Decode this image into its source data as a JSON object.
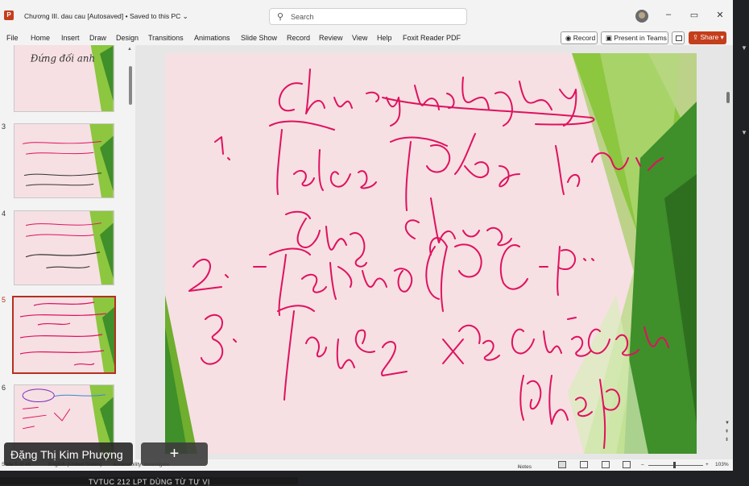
{
  "window": {
    "app_icon": "powerpoint-icon",
    "document_title": "Chương III. dau cau [Autosaved] • Saved to this PC ⌄",
    "search_placeholder": "Search",
    "controls": {
      "minimize": "–",
      "maximize": "▭",
      "close": "✕"
    }
  },
  "ribbon": {
    "tabs": [
      "File",
      "Home",
      "Insert",
      "Draw",
      "Design",
      "Transitions",
      "Animations",
      "Slide Show",
      "Record",
      "Review",
      "View",
      "Help",
      "Foxit Reader PDF"
    ],
    "record_label": "Record",
    "present_label": "Present in Teams",
    "share_label": "Share"
  },
  "thumbnails": {
    "items": [
      {
        "number": "",
        "caption": "Đứng đối anh"
      },
      {
        "number": "3",
        "caption": "Bổ đối đánh đốp thái chữ nhận ngữ ra. Quân tạ quất sấp cân tiến chất liêu"
      },
      {
        "number": "4",
        "caption": "Cho cá nhãy lâng thống cạnh thông đuôi với chiến đi an ơn thơng thiêu đứng thướ"
      },
      {
        "number": "5",
        "caption": "Chiếu vẩy tái phẩy 1. Tái các TP đẳng loại đồng chiếu 2. Tái các TP C-P 3. Tái 2 về của câu ghép"
      },
      {
        "number": "6",
        "caption": "Lệnh mở đích chỗ mà câu"
      }
    ],
    "active_index": 3
  },
  "slide": {
    "handwriting": {
      "title": "Chiếu vẩy tái phẩy",
      "line1": "1. Tái các TP đẳng loại,",
      "line1b": "đồng chiếu",
      "line2": "2. Tái các TP C-P ..",
      "line3": "3. Tái 2 về của câu",
      "line3b": "ghép"
    },
    "ink_color": "#e0115f",
    "green_light": "#8dc63f",
    "green_dark": "#3f8f2a"
  },
  "statusbar": {
    "slide_info": "Slide 5 of 46",
    "language": "English (United States)",
    "accessibility": "Accessibility: Investigate",
    "notes_label": "Notes",
    "zoom": "103%"
  },
  "participant": {
    "name": "Đặng Thị Kim Phượng",
    "add_symbol": "+"
  },
  "outside_caption": "TVTUC 212 LPT DÙNG TỪ TỰ VỊ"
}
